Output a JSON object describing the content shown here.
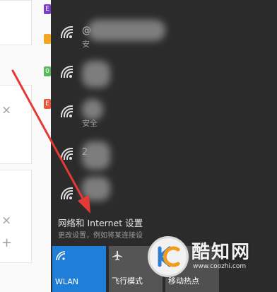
{
  "flyout": {
    "networks": [
      {
        "ssid": "@",
        "sub": "安"
      },
      {
        "ssid": "",
        "sub": ""
      },
      {
        "ssid": "",
        "sub": "安全"
      },
      {
        "ssid": "2",
        "sub": ""
      },
      {
        "ssid": "",
        "sub": ""
      }
    ],
    "settings_link": "网络和 Internet 设置",
    "settings_sub": "更改设置，例如将某连接设",
    "tiles": [
      {
        "label": "WLAN",
        "icon": "wifi-icon",
        "active": true
      },
      {
        "label": "飞行模式",
        "icon": "airplane-icon",
        "active": false
      },
      {
        "label": "移动热点",
        "icon": "hotspot-icon",
        "active": false
      }
    ]
  },
  "background_app": {
    "badges": [
      "E",
      "",
      "0",
      "E"
    ],
    "close_marks": [
      "×",
      "×"
    ],
    "plus_mark": "+"
  },
  "watermark": {
    "title": "酷知网",
    "url": "www.coozhi.com"
  },
  "colors": {
    "flyout_bg": "#2b2b2b",
    "accent": "#1f7fd8",
    "annotation_arrow": "#e53935"
  }
}
